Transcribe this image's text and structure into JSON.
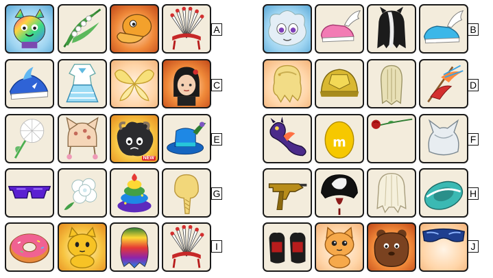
{
  "row_labels": {
    "A": "A",
    "B": "B",
    "C": "C",
    "D": "D",
    "E": "E",
    "F": "F",
    "G": "G",
    "H": "H",
    "I": "I",
    "J": "J"
  },
  "badges": {
    "new": "NEW"
  },
  "rows": [
    {
      "label": "A",
      "items": [
        "rainbow-cat-avatar-icon",
        "lily-of-the-valley-icon",
        "duck-mask-icon",
        "feather-headdress-icon"
      ]
    },
    {
      "label": "B",
      "items": [
        "fluffy-monster-avatar-icon",
        "winged-pink-shoe-icon",
        "black-white-wig-icon",
        "winged-blue-shoe-icon"
      ]
    },
    {
      "label": "C",
      "items": [
        "blue-sneaker-icon",
        "blue-dress-icon",
        "golden-fairy-wings-icon",
        "girl-avatar-icon"
      ]
    },
    {
      "label": "D",
      "items": [
        "blonde-wavy-wig-icon",
        "golden-turtle-shell-icon",
        "braided-blonde-wig-icon",
        "koi-flag-icon"
      ]
    },
    {
      "label": "E",
      "items": [
        "dandelion-icon",
        "cat-ear-hat-icon",
        "black-sheep-avatar-icon",
        "peacock-top-hat-icon"
      ]
    },
    {
      "label": "F",
      "items": [
        "purple-dragon-icon",
        "yellow-egg-icon",
        "red-rose-icon",
        "white-fur-ears-icon"
      ]
    },
    {
      "label": "G",
      "items": [
        "purple-sunglasses-icon",
        "white-flower-icon",
        "rainbow-poop-icon",
        "blonde-braid-wig-icon"
      ]
    },
    {
      "label": "H",
      "items": [
        "golden-gun-icon",
        "skull-hat-icon",
        "platinum-wig-icon",
        "teal-hat-icon"
      ]
    },
    {
      "label": "I",
      "items": [
        "donut-float-icon",
        "yellow-cat-avatar-icon",
        "rainbow-wig-icon",
        "feather-headdress-icon"
      ]
    },
    {
      "label": "J",
      "items": [
        "black-red-fur-boots-icon",
        "orange-kitten-avatar-icon",
        "brown-bear-avatar-icon",
        "blue-goggles-icon"
      ]
    }
  ]
}
